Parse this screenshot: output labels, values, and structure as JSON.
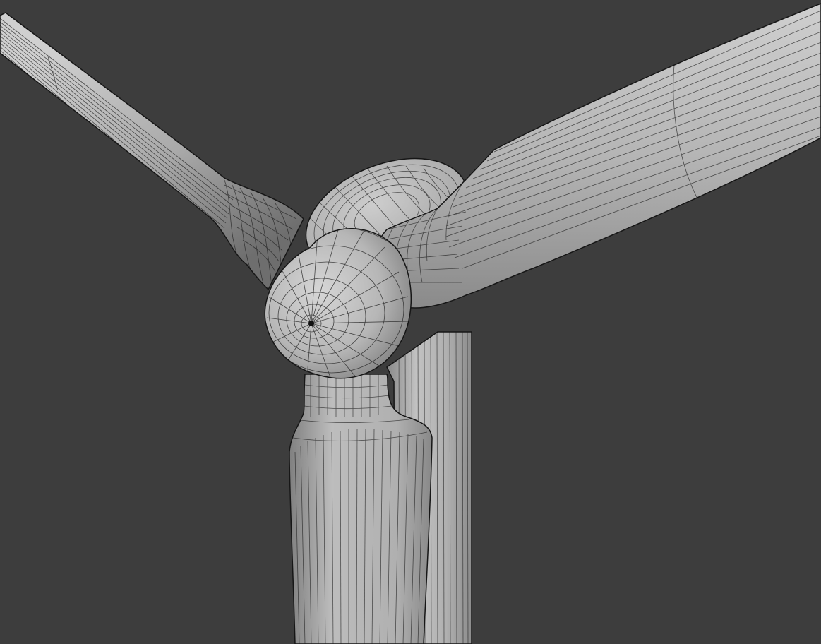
{
  "viewport": {
    "background_color": "#3d3d3d",
    "mesh_fill_color": "#b7b7b7",
    "mesh_shade_color": "#7d7d7d",
    "mesh_highlight_color": "#d2d2d2",
    "wire_color": "#1f1f1f",
    "model": "wind-turbine-wireframe",
    "shading": "solid-with-wireframe-overlay",
    "parts": [
      "tower",
      "nacelle",
      "rotor-hub",
      "spinner-cone",
      "blade-upper-left",
      "blade-right",
      "blade-lower"
    ]
  }
}
